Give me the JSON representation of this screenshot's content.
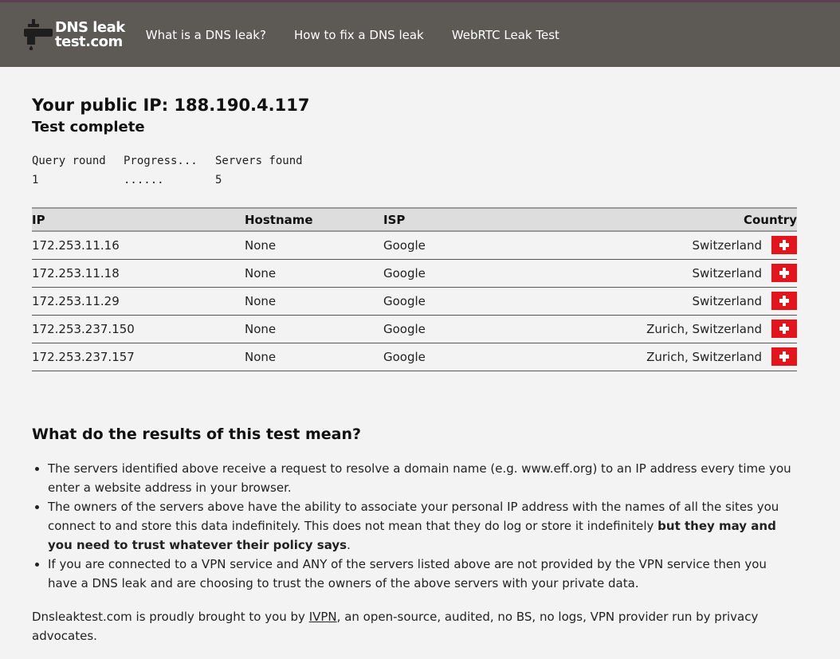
{
  "header": {
    "logo_line1": "DNS leak",
    "logo_line2": "test.com",
    "nav": [
      {
        "label": "What is a DNS leak?"
      },
      {
        "label": "How to fix a DNS leak"
      },
      {
        "label": "WebRTC Leak Test"
      }
    ]
  },
  "title": "Your public IP: 188.190.4.117",
  "status": "Test complete",
  "progress": {
    "headers": [
      "Query round",
      "Progress...",
      "Servers found"
    ],
    "values": [
      "1",
      "......",
      "5"
    ]
  },
  "table": {
    "columns": [
      "IP",
      "Hostname",
      "ISP",
      "Country"
    ],
    "rows": [
      {
        "ip": "172.253.11.16",
        "hostname": "None",
        "isp": "Google",
        "country": "Switzerland"
      },
      {
        "ip": "172.253.11.18",
        "hostname": "None",
        "isp": "Google",
        "country": "Switzerland"
      },
      {
        "ip": "172.253.11.29",
        "hostname": "None",
        "isp": "Google",
        "country": "Switzerland"
      },
      {
        "ip": "172.253.237.150",
        "hostname": "None",
        "isp": "Google",
        "country": "Zurich, Switzerland"
      },
      {
        "ip": "172.253.237.157",
        "hostname": "None",
        "isp": "Google",
        "country": "Zurich, Switzerland"
      }
    ],
    "flag_icon": "swiss-flag-icon"
  },
  "results": {
    "heading": "What do the results of this test mean?",
    "bullet1": "The servers identified above receive a request to resolve a domain name (e.g. www.eff.org) to an IP address every time you enter a website address in your browser.",
    "bullet2_a": "The owners of the servers above have the ability to associate your personal IP address with the names of all the sites you connect to and store this data indefinitely. This does not mean that they do log or store it indefinitely ",
    "bullet2_b": "but they may and you need to trust whatever their policy says",
    "bullet2_c": ".",
    "bullet3": "If you are connected to a VPN service and ANY of the servers listed above are not provided by the VPN service then you have a DNS leak and are choosing to trust the owners of the above servers with your private data."
  },
  "footer": {
    "before": "Dnsleaktest.com is proudly brought to you by ",
    "link": "IVPN",
    "after": ", an open-source, audited, no BS, no logs, VPN provider run by privacy advocates."
  },
  "colors": {
    "header_bg": "#5d5a55",
    "page_bg": "#f3f3f3",
    "flag_red": "#e3141c"
  }
}
